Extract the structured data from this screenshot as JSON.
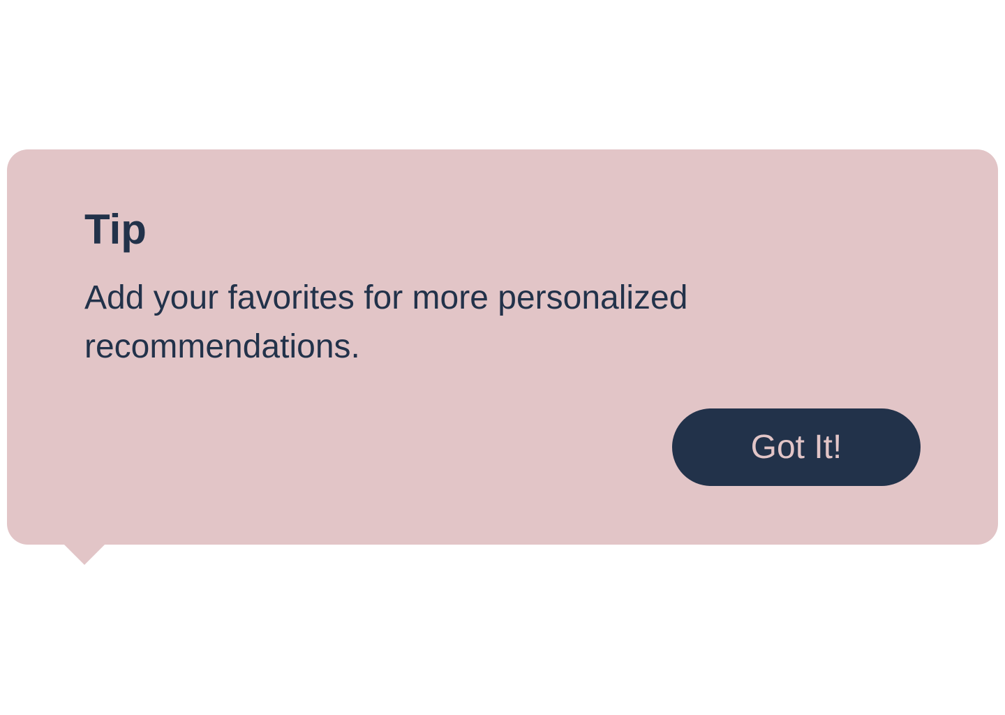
{
  "tooltip": {
    "title": "Tip",
    "message": "Add your favorites for more personalized recommendations.",
    "button_label": "Got It!"
  },
  "colors": {
    "background": "#e2c5c7",
    "text": "#22324a",
    "button_background": "#22324a",
    "button_text": "#e2c5c7"
  }
}
